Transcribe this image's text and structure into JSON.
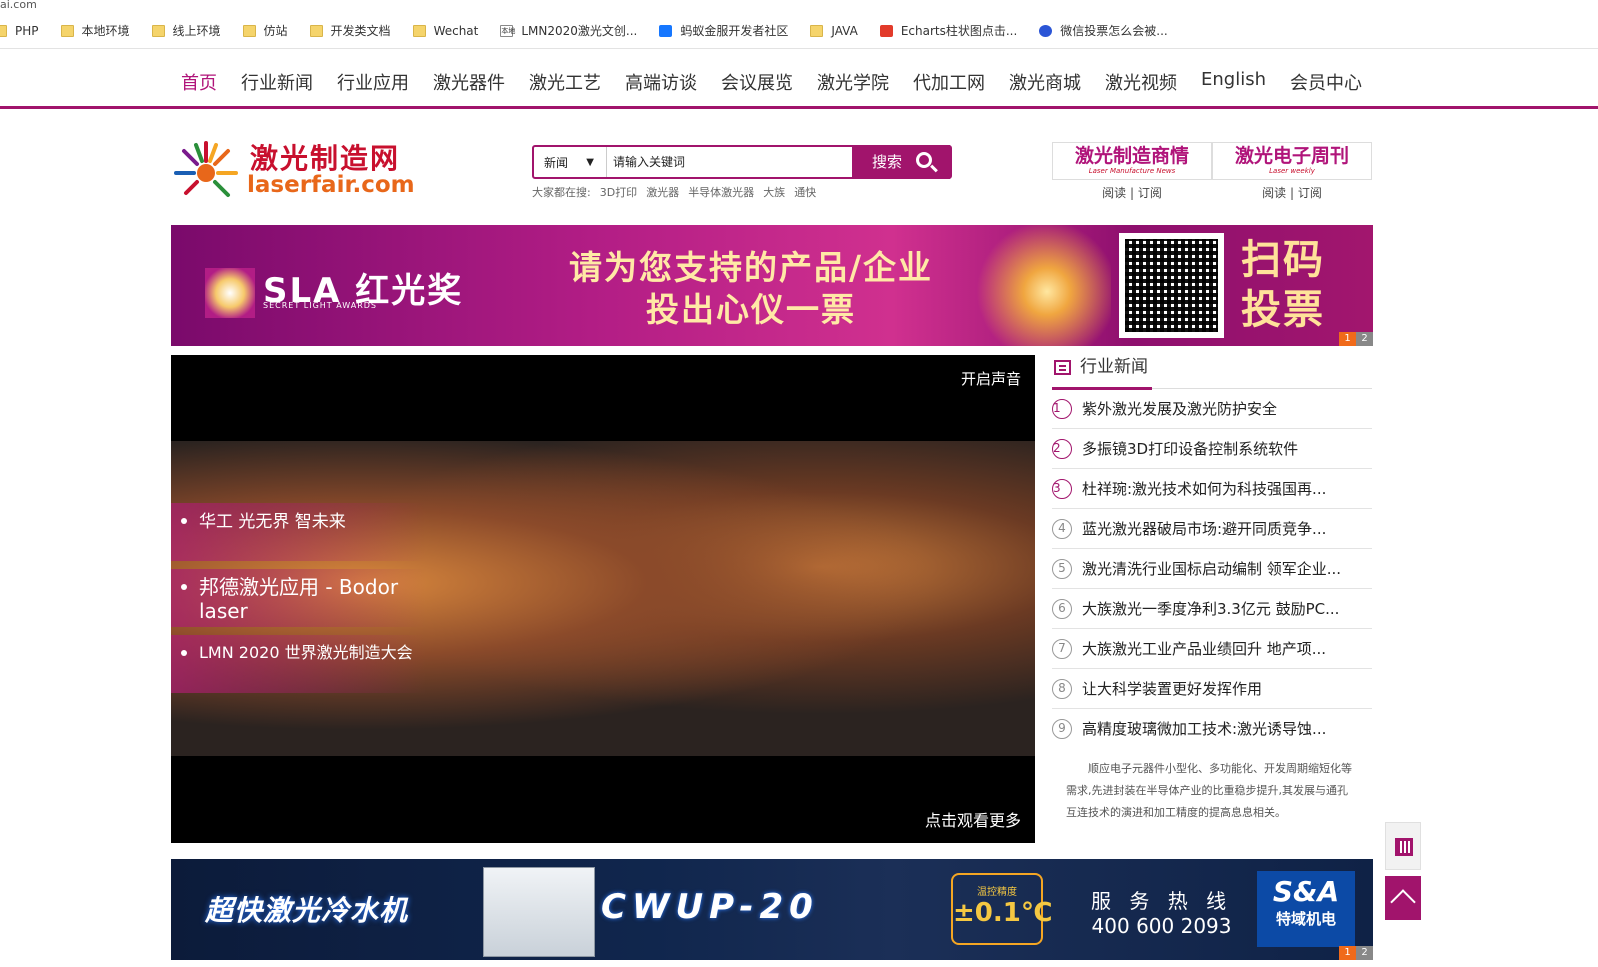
{
  "browser": {
    "url_fragment": "ai.com",
    "bookmarks": [
      {
        "label": "PHP",
        "icon": "folder-icon"
      },
      {
        "label": "本地环境",
        "icon": "folder-icon"
      },
      {
        "label": "线上环境",
        "icon": "folder-icon"
      },
      {
        "label": "仿站",
        "icon": "folder-icon"
      },
      {
        "label": "开发类文档",
        "icon": "folder-icon"
      },
      {
        "label": "Wechat",
        "icon": "folder-icon"
      },
      {
        "label": "LMN2020激光文创...",
        "icon": "site-icon"
      },
      {
        "label": "蚂蚁金服开发者社区",
        "icon": "alipay-icon"
      },
      {
        "label": "JAVA",
        "icon": "folder-icon"
      },
      {
        "label": "Echarts柱状图点击...",
        "icon": "csdn-icon"
      },
      {
        "label": "微信投票怎么会被...",
        "icon": "baidu-icon"
      }
    ],
    "site_icon_text": "本地"
  },
  "nav": {
    "items": [
      "首页",
      "行业新闻",
      "行业应用",
      "激光器件",
      "激光工艺",
      "高端访谈",
      "会议展览",
      "激光学院",
      "代加工网",
      "激光商城",
      "激光视频",
      "English",
      "会员中心"
    ]
  },
  "header": {
    "logo_cn": "激光制造网",
    "logo_en": "laserfair.com",
    "search": {
      "category": "新闻",
      "placeholder": "请输入关键词",
      "button": "搜索"
    },
    "hot_label": "大家都在搜:",
    "hot_terms": [
      "3D打印",
      "激光器",
      "半导体激光器",
      "大族",
      "通快"
    ],
    "publications": [
      {
        "title": "激光制造商情",
        "sub": "Laser Manufacture News",
        "read": "阅读",
        "subscribe": "订阅"
      },
      {
        "title": "激光电子周刊",
        "sub": "Laser weekly",
        "read": "阅读",
        "subscribe": "订阅"
      }
    ],
    "pub_separator": "|"
  },
  "banner1": {
    "brand": "SLA 红光奖",
    "brand_sub": "SECRET LIGHT AWARDS",
    "line1": "请为您支持的产品/企业",
    "line2": "投出心仪一票",
    "cta_line1": "扫码",
    "cta_line2": "投票",
    "pages": [
      "1",
      "2"
    ]
  },
  "video": {
    "sound": "开启声音",
    "more": "点击观看更多",
    "playlist": [
      "华工 光无界 智未来",
      "邦德激光应用 - Bodor laser",
      "LMN 2020 世界激光制造大会"
    ]
  },
  "news": {
    "title": "行业新闻",
    "items": [
      {
        "n": "1",
        "t": "紫外激光发展及激光防护安全"
      },
      {
        "n": "2",
        "t": "多振镜3D打印设备控制系统软件"
      },
      {
        "n": "3",
        "t": "杜祥琬:激光技术如何为科技强国再..."
      },
      {
        "n": "4",
        "t": "蓝光激光器破局市场:避开同质竞争..."
      },
      {
        "n": "5",
        "t": "激光清洗行业国标启动编制 领军企业..."
      },
      {
        "n": "6",
        "t": "大族激光一季度净利3.3亿元 鼓励PC..."
      },
      {
        "n": "7",
        "t": "大族激光工业产品业绩回升 地产项..."
      },
      {
        "n": "8",
        "t": "让大科学装置更好发挥作用"
      },
      {
        "n": "9",
        "t": "高精度玻璃微加工技术:激光诱导蚀..."
      }
    ],
    "summary": "顺应电子元器件小型化、多功能化、开发周期缩短化等需求,先进封装在半导体产业的比重稳步提升,其发展与通孔互连技术的演进和加工精度的提高息息相关。"
  },
  "banner2": {
    "headline": "超快激光冷水机",
    "model": "CWUP-20",
    "temp_label": "温控精度",
    "temp_value": "±0.1℃",
    "hotline_label": "服 务 热 线",
    "hotline": "400 600 2093",
    "brand": "S&A",
    "brand_cn": "特域机电",
    "pages": [
      "1",
      "2"
    ]
  },
  "colors": {
    "accent": "#a1146c",
    "accent_text": "#b0147a",
    "logo_red": "#c8102e",
    "logo_orange": "#e8671a"
  }
}
